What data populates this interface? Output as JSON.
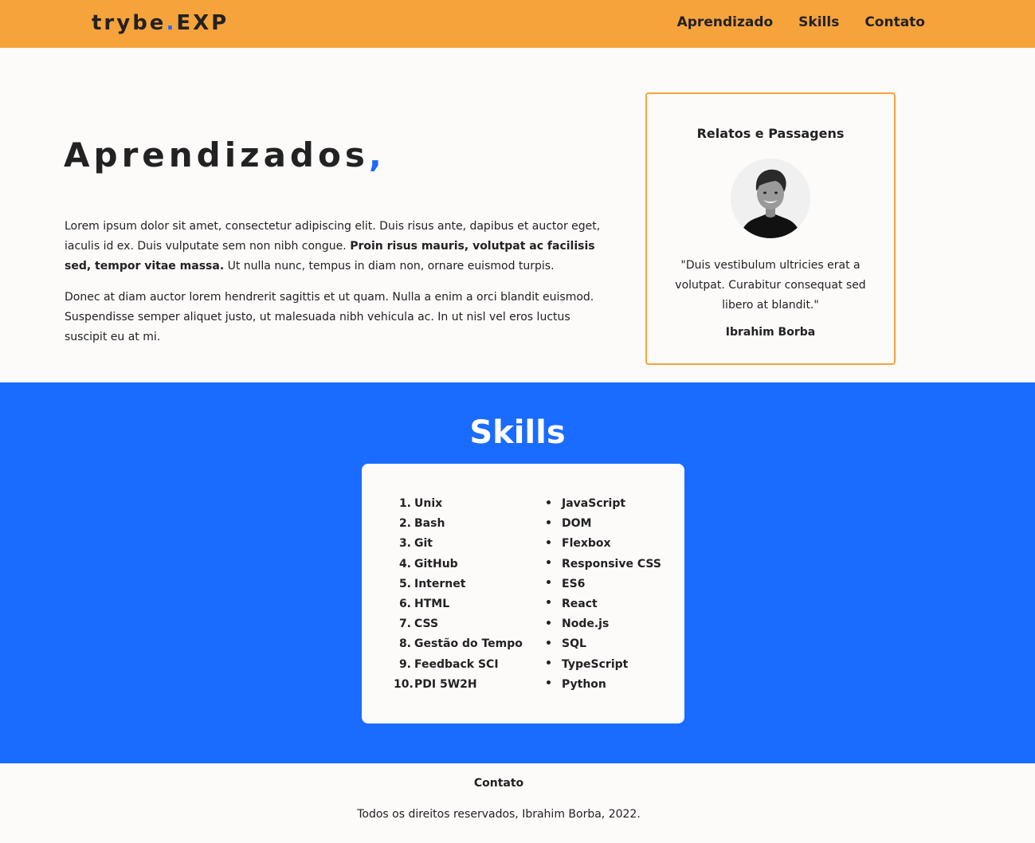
{
  "header": {
    "logo_prefix": "trybe",
    "logo_dot": ".",
    "logo_suffix": "EXP",
    "nav": [
      "Aprendizado",
      "Skills",
      "Contato"
    ]
  },
  "aprendizados": {
    "title": "Aprendizados",
    "title_accent": ",",
    "p1_start": "Lorem ipsum dolor sit amet, consectetur adipiscing elit. Duis risus ante, dapibus et auctor eget, iaculis id ex. Duis vulputate sem non nibh congue. ",
    "p1_bold": "Proin risus mauris, volutpat ac facilisis sed, tempor vitae massa.",
    "p1_end": " Ut nulla nunc, tempus in diam non, ornare euismod turpis.",
    "p2": "Donec at diam auctor lorem hendrerit sagittis et ut quam. Nulla a enim a orci blandit euismod. Suspendisse semper aliquet justo, ut malesuada nibh vehicula ac. In ut nisl vel eros luctus suscipit eu at mi."
  },
  "card": {
    "title": "Relatos e Passagens",
    "quote": "\"Duis vestibulum ultricies erat a volutpat. Curabitur consequat sed libero at blandit.\"",
    "author": "Ibrahim Borba"
  },
  "skills": {
    "title": "Skills",
    "ordered": [
      "Unix",
      "Bash",
      "Git",
      "GitHub",
      "Internet",
      "HTML",
      "CSS",
      "Gestão do Tempo",
      "Feedback SCI",
      "PDI 5W2H"
    ],
    "unordered": [
      "JavaScript",
      "DOM",
      "Flexbox",
      "Responsive CSS",
      "ES6",
      "React",
      "Node.js",
      "SQL",
      "TypeScript",
      "Python"
    ]
  },
  "footer": {
    "contato": "Contato",
    "copyright": "Todos os direitos reservados, Ibrahim Borba, 2022."
  },
  "colors": {
    "header_bg": "#f6a33c",
    "accent_blue": "#1a6bff",
    "page_bg": "#fdfafa"
  }
}
